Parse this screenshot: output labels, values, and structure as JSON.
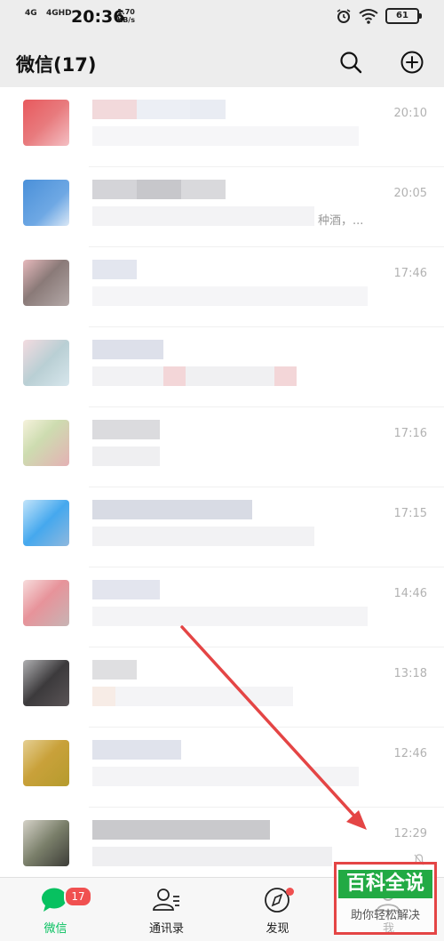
{
  "status_bar": {
    "signal_1": "4G",
    "signal_2": "4GHD",
    "time": "20:36",
    "speed_value": "1.70",
    "speed_unit": "KB/s",
    "battery": "61"
  },
  "header": {
    "title": "微信(17)",
    "search_icon": "search-icon",
    "add_icon": "plus-circle-icon"
  },
  "chats": [
    {
      "time": "20:10",
      "preview": "",
      "avatar_color": "#e8595d"
    },
    {
      "time": "20:05",
      "preview": "种酒，...",
      "avatar_color": "#4a90d9"
    },
    {
      "time": "17:46",
      "preview": "",
      "avatar_color": "#8a7a78"
    },
    {
      "time": "",
      "preview": "",
      "avatar_color": "#b9cfd4"
    },
    {
      "time": "17:16",
      "preview": "",
      "avatar_color": "#cddcb0"
    },
    {
      "time": "17:15",
      "preview": "",
      "avatar_color": "#45a8ee"
    },
    {
      "time": "14:46",
      "preview": "",
      "avatar_color": "#d47f85"
    },
    {
      "time": "13:18",
      "preview": "",
      "avatar_color": "#3c3a3c"
    },
    {
      "time": "12:46",
      "preview": "",
      "avatar_color": "#c9a13a"
    },
    {
      "time": "12:29",
      "preview": "",
      "avatar_color": "#7a7f6a"
    }
  ],
  "tabs": [
    {
      "label": "微信",
      "icon": "chat-bubble-icon",
      "badge": "17"
    },
    {
      "label": "通讯录",
      "icon": "contacts-icon"
    },
    {
      "label": "发现",
      "icon": "compass-icon"
    },
    {
      "label": "我",
      "icon": "person-icon"
    }
  ],
  "watermark": {
    "line1": "百科全说",
    "line2": "助你轻松解决"
  },
  "colors": {
    "accent": "#07c160",
    "badge": "#f05050",
    "annotation": "#e44545"
  }
}
